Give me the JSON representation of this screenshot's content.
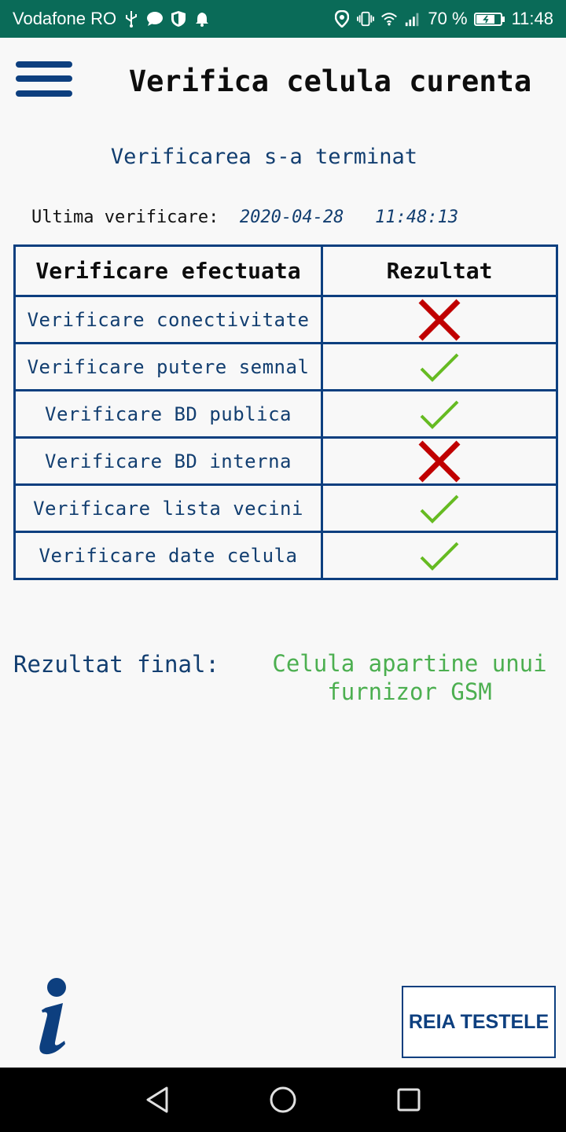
{
  "status_bar": {
    "carrier": "Vodafone RO",
    "battery": "70 %",
    "time": "11:48",
    "icons_left": [
      "usb-icon",
      "chat-icon",
      "shield-icon",
      "bell-icon"
    ],
    "icons_right": [
      "location-icon",
      "vibrate-icon",
      "wifi-icon",
      "signal-icon",
      "battery-icon"
    ]
  },
  "header": {
    "title": "Verifica celula curenta"
  },
  "status_message": "Verificarea s-a terminat",
  "last_check": {
    "label": "Ultima verificare:",
    "date": "2020-04-28",
    "time": "11:48:13"
  },
  "table": {
    "headers": [
      "Verificare efectuata",
      "Rezultat"
    ],
    "rows": [
      {
        "label": "Verificare conectivitate",
        "result": "fail"
      },
      {
        "label": "Verificare putere semnal",
        "result": "pass"
      },
      {
        "label": "Verificare BD publica",
        "result": "pass"
      },
      {
        "label": "Verificare BD interna",
        "result": "fail"
      },
      {
        "label": "Verificare lista vecini",
        "result": "pass"
      },
      {
        "label": "Verificare date celula",
        "result": "pass"
      }
    ]
  },
  "final": {
    "label": "Rezultat final:",
    "value": "Celula apartine unui furnizor GSM"
  },
  "buttons": {
    "retry": "REIA TESTELE",
    "info_icon": "info-icon"
  },
  "nav": [
    "back-icon",
    "home-icon",
    "recents-icon"
  ],
  "colors": {
    "status_bar": "#0a6b58",
    "primary": "#0d3f7f",
    "success": "#4caf50",
    "fail": "#c00000",
    "check": "#66bb22"
  }
}
